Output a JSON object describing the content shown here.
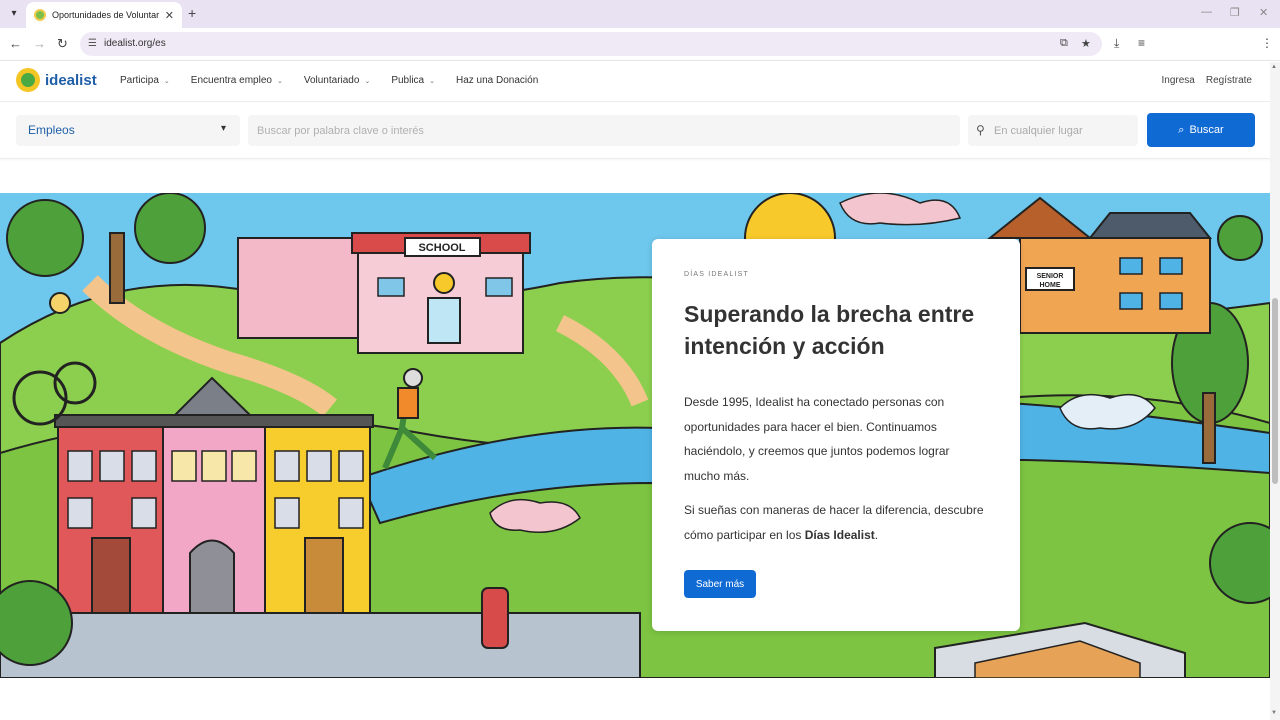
{
  "browser": {
    "tab_title": "Oportunidades de Voluntariado",
    "url": "idealist.org/es"
  },
  "header": {
    "logo": "idealist",
    "nav": [
      {
        "label": "Participa",
        "dropdown": true
      },
      {
        "label": "Encuentra empleo",
        "dropdown": true
      },
      {
        "label": "Voluntariado",
        "dropdown": true
      },
      {
        "label": "Publica",
        "dropdown": true
      },
      {
        "label": "Haz una Donación",
        "dropdown": false
      }
    ],
    "login": "Ingresa",
    "register": "Regístrate"
  },
  "search": {
    "category": "Empleos",
    "keyword_placeholder": "Buscar por palabra clave o interés",
    "location_placeholder": "En cualquier lugar",
    "button": "Buscar"
  },
  "hero": {
    "illustration_labels": {
      "school": "SCHOOL",
      "senior_home_1": "SENIOR",
      "senior_home_2": "HOME"
    },
    "eyebrow": "DÍAS IDEALIST",
    "title": "Superando la brecha entre intención y acción",
    "p1": "Desde 1995, Idealist ha conectado personas con oportunidades para hacer el bien. Continuamos haciéndolo, y creemos que juntos podemos lograr mucho más.",
    "p2_prefix": "Si sueñas con maneras de hacer la diferencia, descubre cómo participar en los ",
    "p2_bold": "Días Idealist",
    "p2_suffix": ".",
    "cta": "Saber más"
  },
  "colors": {
    "primary_blue": "#0f6ad4",
    "logo_blue": "#1f5fa8",
    "sky": "#6ec7ec",
    "grass": "#8ccf4e"
  }
}
